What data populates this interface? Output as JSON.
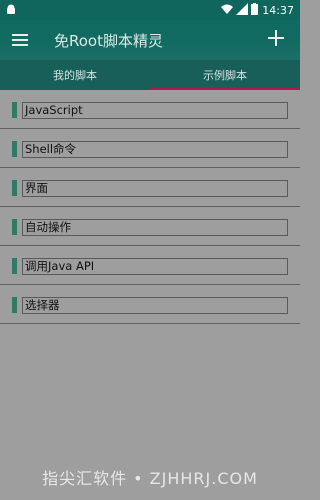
{
  "statusbar": {
    "time": "14:37",
    "icons": [
      "android-robot-icon",
      "wifi-icon",
      "signal-icon",
      "battery-icon"
    ]
  },
  "appbar": {
    "title": "免Root脚本精灵"
  },
  "tabs": [
    {
      "label": "我的脚本",
      "active": false
    },
    {
      "label": "示例脚本",
      "active": true
    }
  ],
  "scripts": [
    {
      "label": "JavaScript"
    },
    {
      "label": "Shell命令"
    },
    {
      "label": "界面"
    },
    {
      "label": "自动操作"
    },
    {
      "label": "调用Java API"
    },
    {
      "label": "选择器"
    }
  ],
  "watermark": "指尖汇软件 • ZJHHRJ.COM",
  "colors": {
    "primary": "#10665c",
    "tab_bar": "#175f58",
    "tab_indicator": "#b3174b",
    "item_marker": "#2f7a66",
    "background": "#9e9e9e"
  }
}
